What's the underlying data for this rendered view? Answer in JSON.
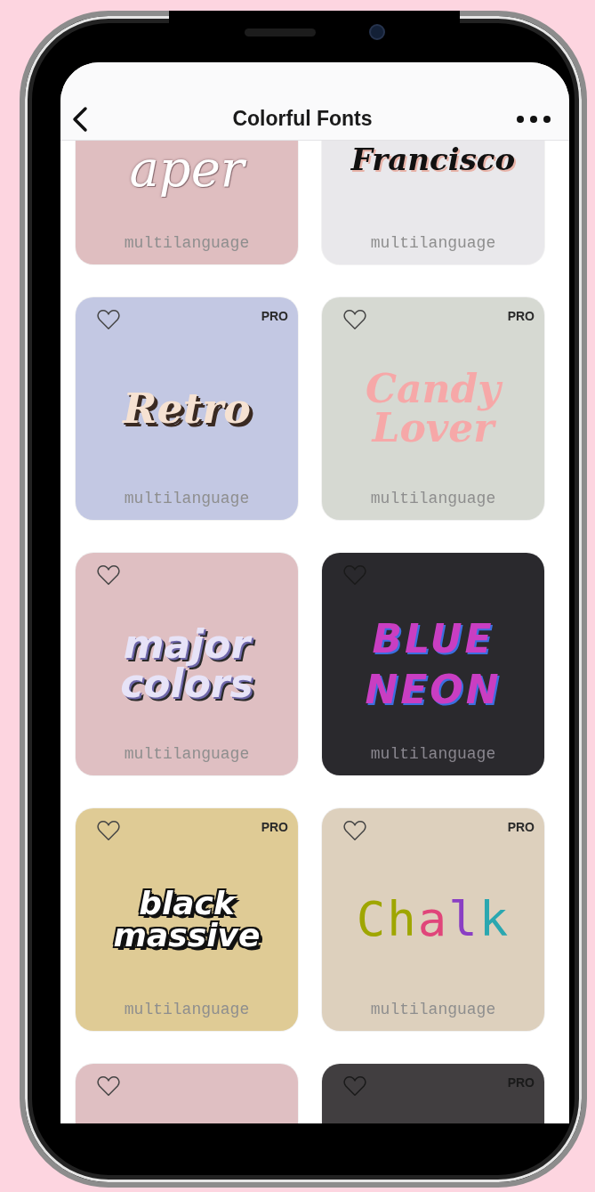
{
  "header": {
    "title": "Colorful Fonts"
  },
  "cards": [
    {
      "kind": "script",
      "sample": "aper",
      "caption": "multilanguage",
      "color": "#dfbec0"
    },
    {
      "kind": "francisco",
      "sample": "Francisco",
      "caption": "multilanguage",
      "color": "#e9e8eb"
    },
    {
      "kind": "retro",
      "sample": "Retro",
      "caption": "multilanguage",
      "color": "#c3c8e3",
      "pro_label": "PRO"
    },
    {
      "kind": "candy",
      "sample": "Candy Lover",
      "caption": "multilanguage",
      "color": "#d6d9d2",
      "pro_label": "PRO"
    },
    {
      "kind": "major",
      "sample": "major colors",
      "caption": "multilanguage",
      "color": "#dfbfc2"
    },
    {
      "kind": "neon",
      "sample": "BLUE NEON",
      "caption": "multilanguage",
      "color": "#2a292d"
    },
    {
      "kind": "massive",
      "sample": "black massive",
      "caption": "multilanguage",
      "color": "#dfcb95",
      "pro_label": "PRO"
    },
    {
      "kind": "chalk",
      "sample": "Chalk",
      "caption": "multilanguage",
      "color": "#ddd0bd",
      "pro_label": "PRO"
    },
    {
      "kind": "blank",
      "color": "#dfbfc2"
    },
    {
      "kind": "neon-script",
      "color": "#413e40",
      "pro_label": "PRO"
    }
  ]
}
